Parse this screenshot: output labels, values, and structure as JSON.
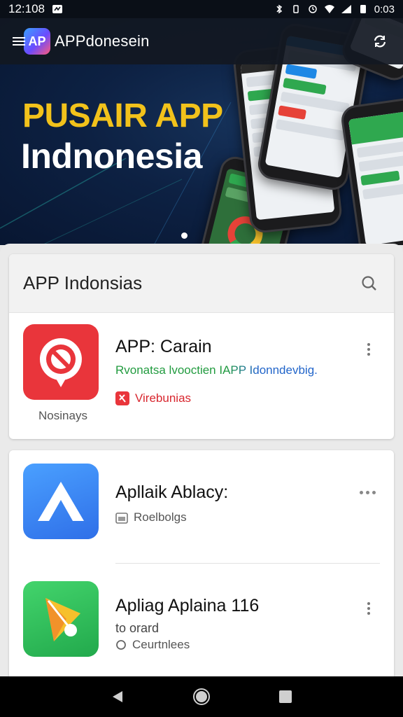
{
  "status_bar": {
    "time": "12:108",
    "battery": "0:03"
  },
  "app_bar": {
    "logo_text": "AP",
    "title": "APPdonesein"
  },
  "hero": {
    "line1": "PUSAIR APP",
    "line2": "Indnonesia"
  },
  "section": {
    "title": "APP Indonsias"
  },
  "apps": [
    {
      "name": "APP: Carain",
      "description": "Rvonatsa lvooctien IAPP Idonndevbig.",
      "tag": "Virebunias",
      "caption": "Nosinays"
    },
    {
      "name": "Apllaik Ablacy:",
      "tag": "Roelbolgs"
    },
    {
      "name": "Apliag Aplaina  116",
      "subtitle": "to orard",
      "tag": "Ceurtnlees"
    }
  ],
  "colors": {
    "accent_yellow": "#f2c21b",
    "hero_bg": "#0d2143",
    "red_app": "#e9353b",
    "blue_app": "#2f7cf0",
    "green_app": "#34c060",
    "desc_green": "#1f9a3d",
    "desc_blue": "#1f63c9"
  },
  "icons": [
    "menu-icon",
    "sync-icon",
    "search-icon",
    "more-vert-icon",
    "more-horiz-icon",
    "back-icon",
    "home-icon",
    "recents-icon"
  ]
}
